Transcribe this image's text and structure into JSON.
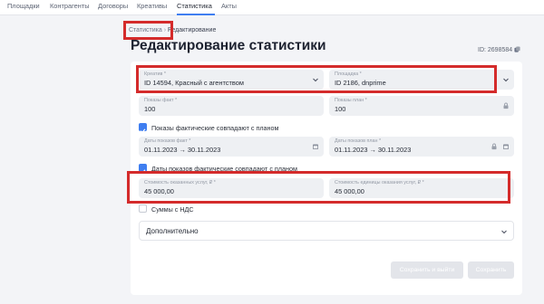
{
  "nav": {
    "items": [
      {
        "label": "Площадки",
        "active": false
      },
      {
        "label": "Контрагенты",
        "active": false
      },
      {
        "label": "Договоры",
        "active": false
      },
      {
        "label": "Креативы",
        "active": false
      },
      {
        "label": "Статистика",
        "active": true
      },
      {
        "label": "Акты",
        "active": false
      }
    ],
    "accent_color": "#3f7ef0"
  },
  "breadcrumb": {
    "parent": "Статистика",
    "separator": "›",
    "current": "Редактирование"
  },
  "page": {
    "title": "Редактирование статистики",
    "record_id": "ID: 2698584",
    "copy_icon": "copy-icon"
  },
  "form": {
    "creative": {
      "label": "Креатив *",
      "value": "ID 14594, Красный с агентством",
      "icon": "chevron-down-icon"
    },
    "platform": {
      "label": "Площадка *",
      "value": "ID 2186, dnprime",
      "icon": "chevron-down-icon"
    },
    "impressions_fact": {
      "label": "Показы факт *",
      "value": "100"
    },
    "impressions_plan": {
      "label": "Показы план *",
      "value": "100",
      "icon": "lock-icon"
    },
    "impressions_match": {
      "label": "Показы фактические совпадают с планом",
      "checked": true
    },
    "dates_fact": {
      "label": "Даты показов факт *",
      "value": "01.11.2023 → 30.11.2023",
      "icon": "calendar-icon"
    },
    "dates_plan": {
      "label": "Даты показов план *",
      "value": "01.11.2023 → 30.11.2023",
      "icons": [
        "lock-icon",
        "calendar-icon"
      ]
    },
    "dates_match": {
      "label": "Даты показов фактические совпадают с планом",
      "checked": true
    },
    "services_cost": {
      "label": "Стоимость оказанных услуг, ₽ *",
      "value": "45 000,00"
    },
    "unit_cost": {
      "label": "Стоимость единицы оказания услуг, ₽ *",
      "value": "45 000,00"
    },
    "vat": {
      "label": "Суммы с НДС",
      "checked": false
    },
    "additional": {
      "label": "Дополнительно",
      "icon": "chevron-down-icon"
    }
  },
  "actions": {
    "save_and_exit": "Сохранить и выйти",
    "save": "Сохранить"
  },
  "colors": {
    "highlight": "#d42b2b",
    "checkbox": "#3f7ef0",
    "disabled_button": "#e3e5ea"
  }
}
